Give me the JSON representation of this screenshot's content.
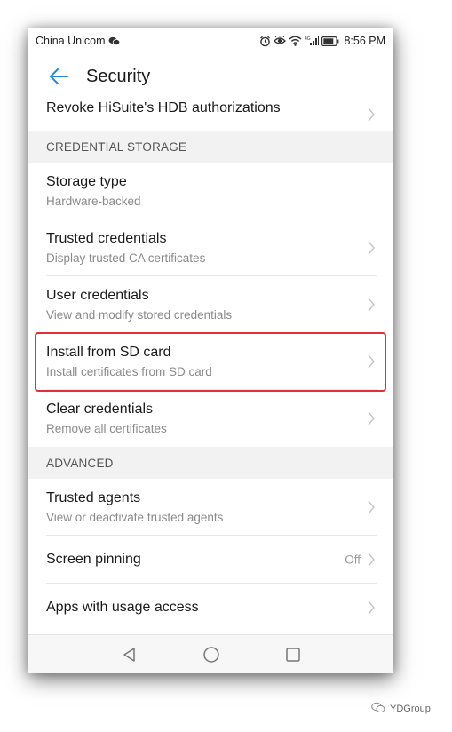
{
  "status_bar": {
    "carrier": "China Unicom",
    "time": "8:56 PM",
    "icons": [
      "wechat-icon",
      "alarm-icon",
      "eye-icon",
      "wifi-icon",
      "signal-icon",
      "battery-icon"
    ]
  },
  "app_bar": {
    "back_icon": "arrow-back-icon",
    "title": "Security"
  },
  "top_row": {
    "title": "Revoke HiSuite's HDB authorizations"
  },
  "sections": {
    "credential_storage": "CREDENTIAL STORAGE",
    "advanced": "ADVANCED"
  },
  "credential_items": [
    {
      "title": "Storage type",
      "subtitle": "Hardware-backed"
    },
    {
      "title": "Trusted credentials",
      "subtitle": "Display trusted CA certificates"
    },
    {
      "title": "User credentials",
      "subtitle": "View and modify stored credentials"
    },
    {
      "title": "Install from SD card",
      "subtitle": "Install certificates from SD card",
      "highlighted": true
    },
    {
      "title": "Clear credentials",
      "subtitle": "Remove all certificates"
    }
  ],
  "advanced_items": [
    {
      "title": "Trusted agents",
      "subtitle": "View or deactivate trusted agents"
    },
    {
      "title": "Screen pinning",
      "value": "Off"
    },
    {
      "title": "Apps with usage access"
    }
  ],
  "nav_bar": {
    "icons": [
      "back-triangle-icon",
      "home-circle-icon",
      "recents-square-icon"
    ]
  },
  "watermark": {
    "text": "YDGroup"
  },
  "colors": {
    "accent": "#1e88e5",
    "highlight": "#e0303a",
    "section_bg": "#f2f2f2"
  }
}
